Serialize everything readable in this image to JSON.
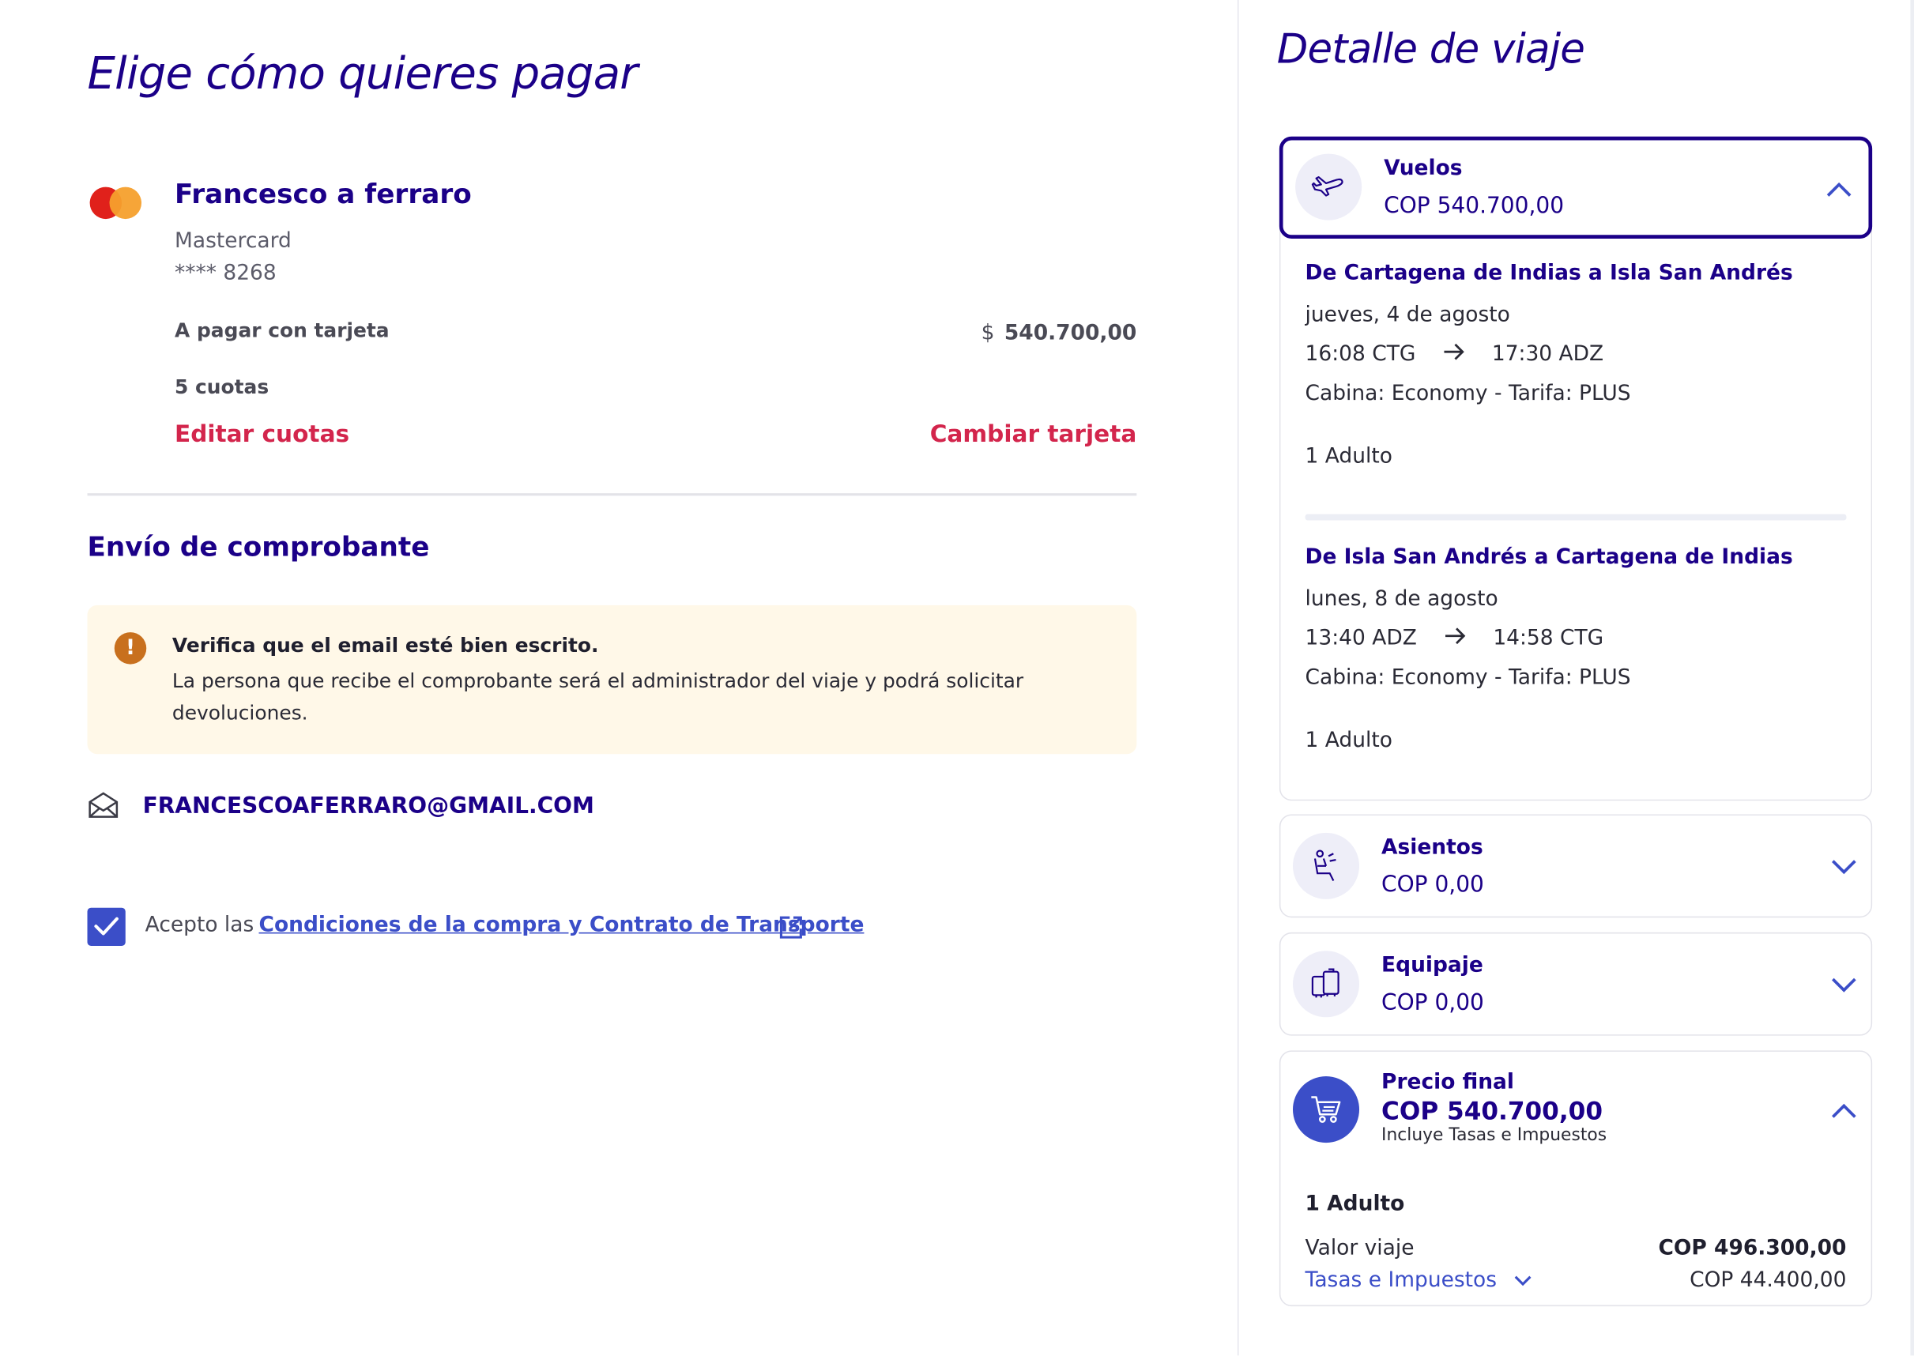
{
  "payment": {
    "title": "Elige cómo quieres pagar",
    "card": {
      "holder": "Francesco a ferraro",
      "brand": "Mastercard",
      "number": "**** 8268"
    },
    "pay_label": "A pagar con tarjeta",
    "currency_symbol": "$",
    "amount": "540.700,00",
    "installments": "5 cuotas",
    "edit_installments": "Editar cuotas",
    "change_card": "Cambiar tarjeta"
  },
  "receipt": {
    "title": "Envío de comprobante",
    "alert_title": "Verifica que el email esté bien escrito.",
    "alert_text": "La persona que recibe el comprobante será el administrador del viaje y podrá solicitar devoluciones.",
    "email": "FRANCESCOAFERRARO@GMAIL.COM"
  },
  "terms": {
    "prefix": "Acepto las",
    "link": "Condiciones de la compra y Contrato de Transporte",
    "checked": true
  },
  "trip": {
    "title": "Detalle de viaje",
    "flights": {
      "label": "Vuelos",
      "price": "COP 540.700,00",
      "segments": [
        {
          "route": "De Cartagena de Indias a Isla San Andrés",
          "date": "jueves, 4 de agosto",
          "depart": "16:08 CTG",
          "arrive": "17:30 ADZ",
          "cabin": "Cabina: Economy - Tarifa: PLUS",
          "passengers": "1 Adulto"
        },
        {
          "route": "De Isla San Andrés a Cartagena de Indias",
          "date": "lunes, 8 de agosto",
          "depart": "13:40 ADZ",
          "arrive": "14:58 CTG",
          "cabin": "Cabina: Economy - Tarifa: PLUS",
          "passengers": "1 Adulto"
        }
      ]
    },
    "seats": {
      "label": "Asientos",
      "price": "COP 0,00"
    },
    "baggage": {
      "label": "Equipaje",
      "price": "COP 0,00"
    },
    "final": {
      "label": "Precio final",
      "price": "COP 540.700,00",
      "note": "Incluye Tasas e Impuestos",
      "passengers": "1 Adulto",
      "fare_label": "Valor viaje",
      "fare_value": "COP 496.300,00",
      "taxes_label": "Tasas e Impuestos",
      "taxes_value": "COP 44.400,00"
    }
  },
  "colors": {
    "primary": "#1b0088",
    "accent": "#3b4ec8",
    "link_red": "#d3254c",
    "alert_bg": "#fff8e8",
    "alert_icon": "#c8701e"
  }
}
